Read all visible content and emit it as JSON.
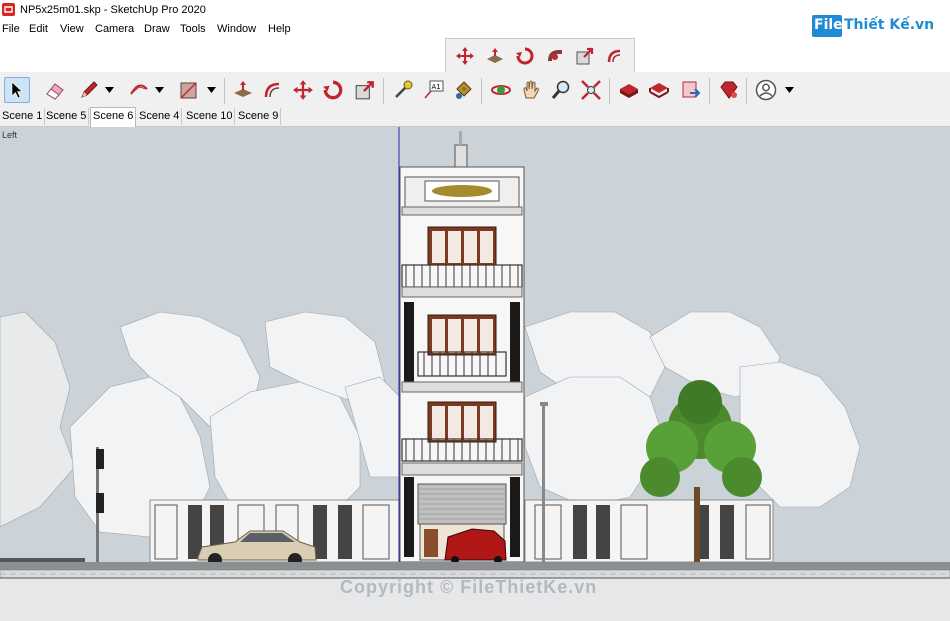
{
  "window": {
    "title": "NP5x25m01.skp - SketchUp Pro 2020"
  },
  "menu": [
    "File",
    "Edit",
    "View",
    "Camera",
    "Draw",
    "Tools",
    "Window",
    "Help"
  ],
  "brand": {
    "logo_text": "File",
    "name": "Thiết Kế.vn"
  },
  "floating_toolbar": [
    "move-icon",
    "push-pull-icon",
    "rotate-icon",
    "follow-me-icon",
    "scale-icon",
    "offset-icon"
  ],
  "main_toolbar": {
    "group1": [
      "select-icon",
      "eraser-icon",
      "pencil-icon",
      "arc-icon",
      "rectangle-icon"
    ],
    "group2": [
      "push-pull-icon",
      "offset-icon",
      "move-icon",
      "rotate-icon",
      "scale-icon"
    ],
    "group3": [
      "tape-measure-icon",
      "text-label-icon",
      "paint-bucket-icon"
    ],
    "group4": [
      "orbit-icon",
      "pan-icon",
      "zoom-icon",
      "zoom-extents-icon"
    ],
    "group5": [
      "warehouse-icon",
      "extension-warehouse-icon",
      "send-to-layout-icon"
    ],
    "group6": [
      "ruby-icon"
    ],
    "group7": [
      "account-icon"
    ]
  },
  "scene_tabs": [
    {
      "label": "Scene 1",
      "active": false
    },
    {
      "label": "Scene 5",
      "active": false
    },
    {
      "label": "Scene 6",
      "active": true
    },
    {
      "label": "Scene 4",
      "active": false
    },
    {
      "label": "Scene 10",
      "active": false
    },
    {
      "label": "Scene 9",
      "active": false
    }
  ],
  "viewport": {
    "view_name": "Left",
    "watermark": "Copyright © FileThietKe.vn",
    "colors": {
      "sky": "#cbd3d9",
      "ground": "#9aa0a6",
      "axis": "#2a2aa8"
    }
  }
}
